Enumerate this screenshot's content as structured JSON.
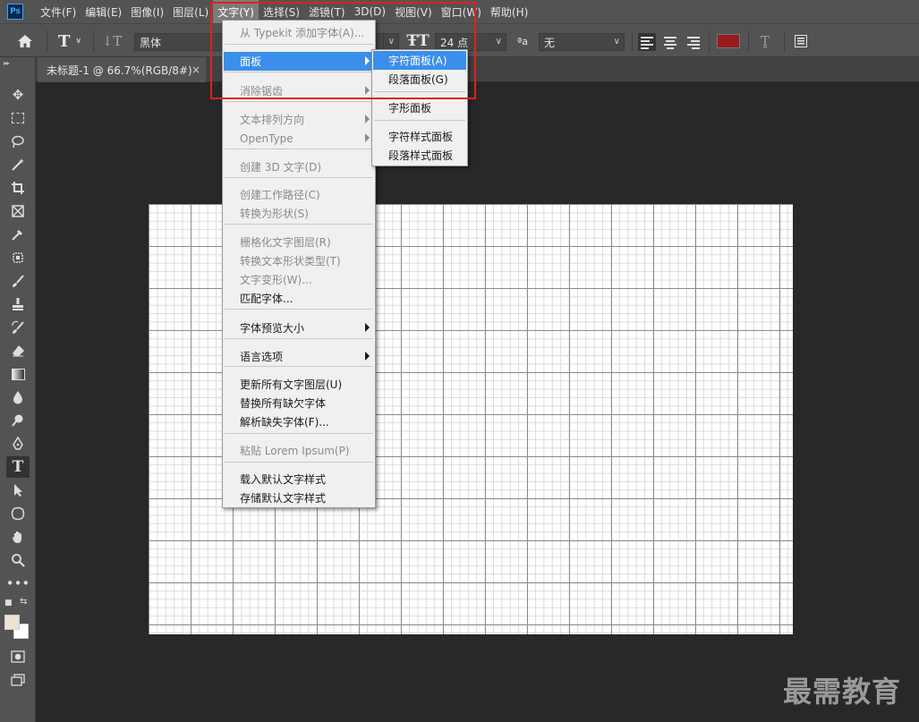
{
  "app": {
    "logo_text": "Ps"
  },
  "menubar": {
    "items": [
      "文件(F)",
      "编辑(E)",
      "图像(I)",
      "图层(L)",
      "文字(Y)",
      "选择(S)",
      "滤镜(T)",
      "3D(D)",
      "视图(V)",
      "窗口(W)",
      "帮助(H)"
    ],
    "active_index": 4
  },
  "options": {
    "font_family": "黑体",
    "font_size": "24 点",
    "anti_alias_icon": "ªa",
    "anti_alias_value": "无",
    "text_color": "#9b1a1e"
  },
  "document": {
    "tab_title": "未标题-1 @ 66.7%(RGB/8#)",
    "close_glyph": "×"
  },
  "type_menu": {
    "items": [
      {
        "label": "从 Typekit 添加字体(A)...",
        "disabled": true
      },
      {
        "label": "面板",
        "submenu": true,
        "highlighted": true
      },
      {
        "label": "消除锯齿",
        "disabled": true,
        "submenu": true
      },
      {
        "label": "文本排列方向",
        "disabled": true,
        "submenu": true
      },
      {
        "label": "OpenType",
        "disabled": true,
        "submenu": true
      },
      {
        "label": "创建 3D 文字(D)",
        "disabled": true
      },
      {
        "label": "创建工作路径(C)",
        "disabled": true
      },
      {
        "label": "转换为形状(S)",
        "disabled": true
      },
      {
        "label": "栅格化文字图层(R)",
        "disabled": true
      },
      {
        "label": "转换文本形状类型(T)",
        "disabled": true
      },
      {
        "label": "文字变形(W)...",
        "disabled": true
      },
      {
        "label": "匹配字体..."
      },
      {
        "label": "字体预览大小",
        "submenu": true
      },
      {
        "label": "语言选项",
        "submenu": true
      },
      {
        "label": "更新所有文字图层(U)"
      },
      {
        "label": "替换所有缺欠字体"
      },
      {
        "label": "解析缺失字体(F)..."
      },
      {
        "label": "粘贴 Lorem Ipsum(P)",
        "disabled": true
      },
      {
        "label": "载入默认文字样式"
      },
      {
        "label": "存储默认文字样式"
      }
    ]
  },
  "panel_submenu": {
    "items": [
      {
        "label": "字符面板(A)",
        "highlighted": true
      },
      {
        "label": "段落面板(G)"
      },
      {
        "label": "字形面板"
      },
      {
        "label": "字符样式面板"
      },
      {
        "label": "段落样式面板"
      }
    ]
  },
  "colors": {
    "highlight": "#3b8eea",
    "annotation_box": "#e02020",
    "foreground_swatch": "#ede3d0",
    "background_swatch": "#ffffff"
  },
  "watermark": {
    "text": "最需教育"
  }
}
